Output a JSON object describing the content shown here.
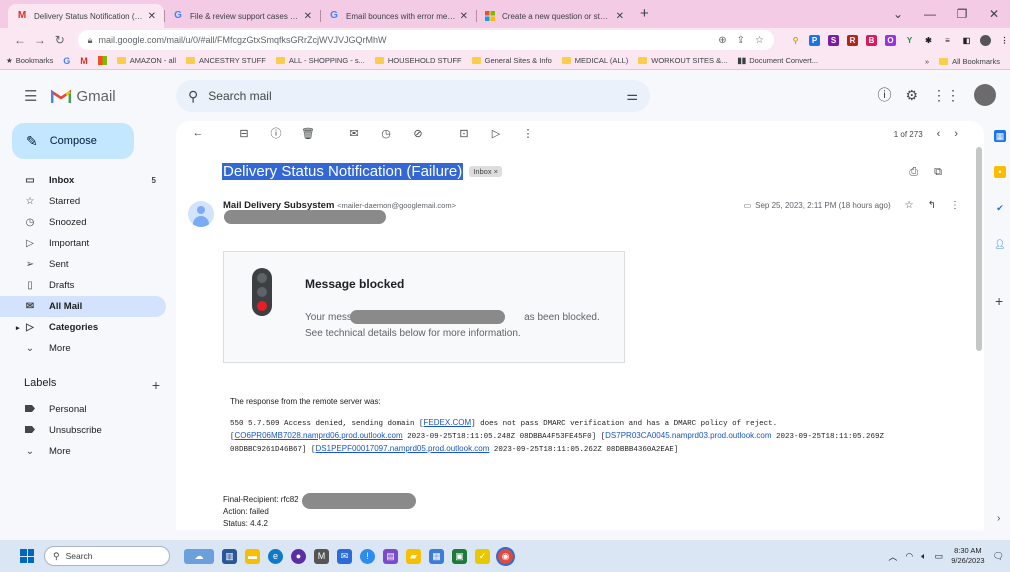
{
  "browser": {
    "tabs": [
      {
        "title": "Delivery Status Notification (Fail",
        "favicon": "gmail-icon",
        "active": true
      },
      {
        "title": "File & review support cases - Go",
        "favicon": "google-icon",
        "active": false
      },
      {
        "title": "Email bounces with error messa",
        "favicon": "google-icon",
        "active": false
      },
      {
        "title": "Create a new question or start a",
        "favicon": "windows-icon",
        "active": false
      }
    ],
    "new_tab": "+",
    "url": "mail.google.com/mail/u/0/#all/FMfcgzGtxSmqfksGRrZcjWVJVJGQrMhW",
    "bookmarks": [
      "Bookmarks",
      "AMAZON - all",
      "ANCESTRY STUFF",
      "ALL - SHOPPING - s...",
      "HOUSEHOLD STUFF",
      "General Sites & Info",
      "MEDICAL (ALL)",
      "WORKOUT SITES &...",
      "Document Convert..."
    ],
    "all_bookmarks": "All Bookmarks",
    "overflow": "»"
  },
  "gmail": {
    "logo_text": "Gmail",
    "search_placeholder": "Search mail",
    "compose": "Compose",
    "nav": [
      {
        "label": "Inbox",
        "icon": "inbox-icon",
        "count": "5",
        "bold": true
      },
      {
        "label": "Starred",
        "icon": "star-icon"
      },
      {
        "label": "Snoozed",
        "icon": "clock-icon"
      },
      {
        "label": "Important",
        "icon": "important-icon"
      },
      {
        "label": "Sent",
        "icon": "send-icon"
      },
      {
        "label": "Drafts",
        "icon": "draft-icon"
      },
      {
        "label": "All Mail",
        "icon": "all-mail-icon",
        "active": true
      },
      {
        "label": "Categories",
        "icon": "label-icon",
        "bold": true
      },
      {
        "label": "More",
        "icon": "chevron-down-icon"
      }
    ],
    "labels_heading": "Labels",
    "labels": [
      {
        "label": "Personal"
      },
      {
        "label": "Unsubscribe"
      },
      {
        "label": "More"
      }
    ]
  },
  "message": {
    "pager": "1 of 273",
    "subject": "Delivery Status Notification (Failure)",
    "badge": "Inbox ×",
    "sender_name": "Mail Delivery Subsystem",
    "sender_addr": "<mailer-daemon@googlemail.com>",
    "date": "Sep 25, 2023, 2:11 PM (18 hours ago)",
    "block_title": "Message blocked",
    "block_text_a": "Your message t",
    "block_text_b": "as been blocked. See technical details below for more information.",
    "response_lead": "The response from the remote server was:",
    "smtp_1": "550 5.7.509 Access denied, sending domain [",
    "link_fedex": "FEDEX.COM",
    "smtp_2": "] does not pass DMARC verification and has a DMARC policy of reject. [",
    "link_1": "CO6PR06MB7028.namprd06.prod.outlook.com",
    "smtp_3": " 2023-09-25T18:11:05.248Z 08DBBA4F53FE45F0] [",
    "link_2": "DS7PR03CA0045.namprd03.prod.outlook.com",
    "smtp_4": " 2023-09-25T18:11:05.269Z 08DBBC9261D46B67] [",
    "link_3": "DS1PEPF00017097.namprd05.prod.outlook.com",
    "smtp_5": " 2023-09-25T18:11:05.262Z 08DBBB4360A2EAE]",
    "final_recipient": "Final-Recipient: rfc82",
    "action": "Action: failed",
    "status": "Status: 4.4.2"
  },
  "taskbar": {
    "search": "Search",
    "time": "8:30 AM",
    "date": "9/26/2023"
  },
  "colors": {
    "tab_strip": "#f3cbe4",
    "compose_bg": "#c2e7ff",
    "active_nav": "#d3e3fd",
    "selection": "#3367d6",
    "link": "#1a55c8"
  }
}
